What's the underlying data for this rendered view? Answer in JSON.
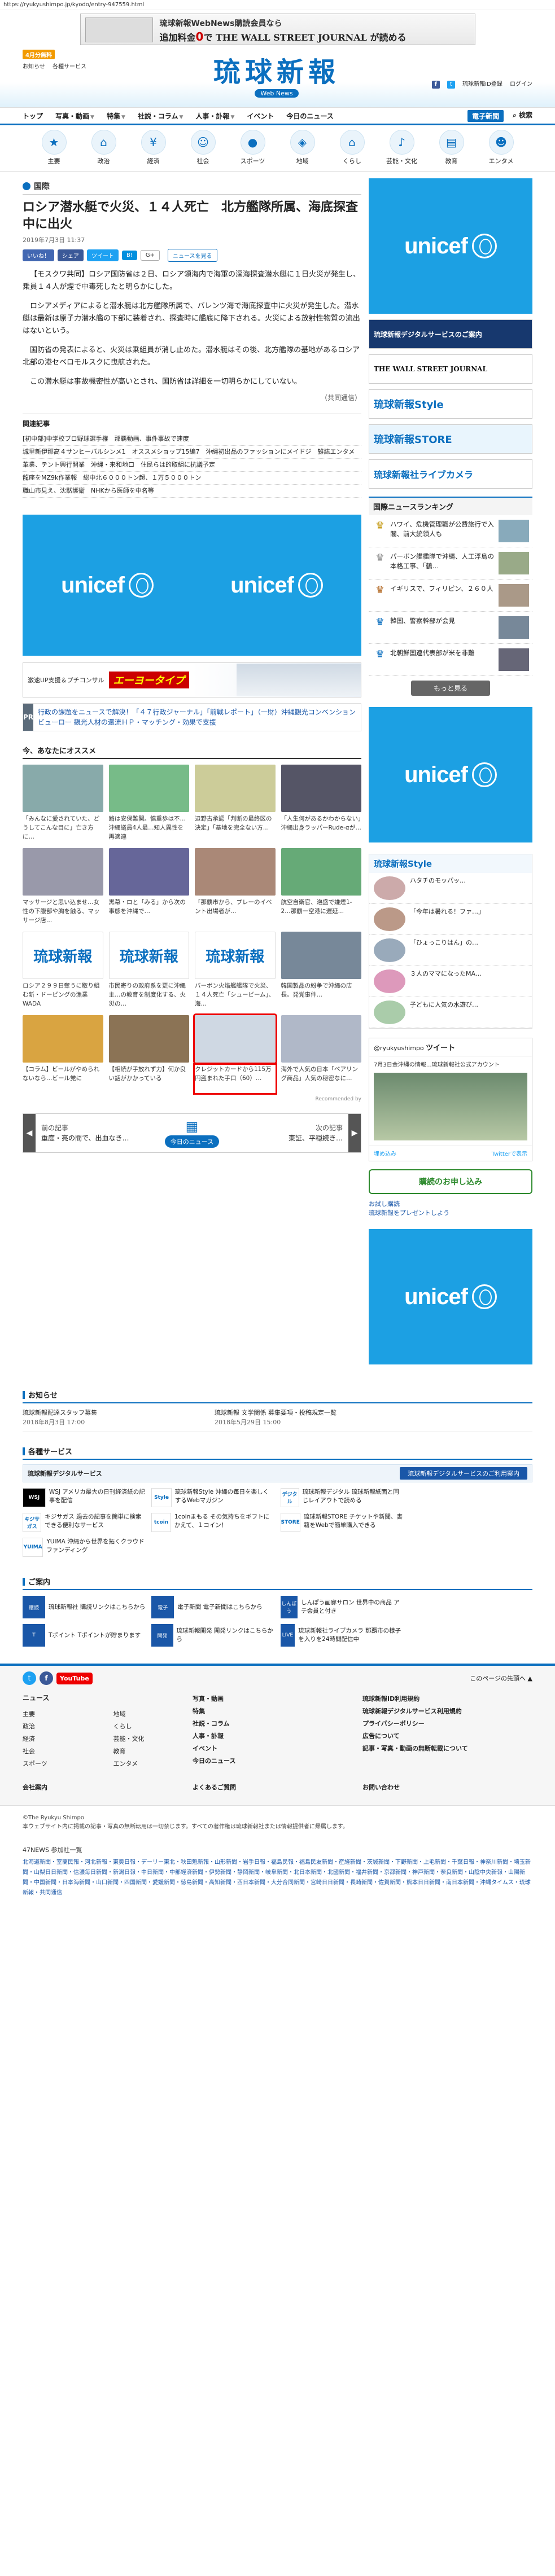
{
  "url": "https://ryukyushimpo.jp/kyodo/entry-947559.html",
  "banner": {
    "line1": "琉球新報WebNews購読会員なら",
    "line2_prefix": "追加料金",
    "line2_price": "0",
    "line2_suffix": "で THE WALL STREET JOURNAL が読める"
  },
  "header": {
    "badge": "4月分無料",
    "left_links": [
      "お知らせ",
      "各種サービス"
    ],
    "logo": "琉球新報",
    "logo_sub": "Web News",
    "right_links": [
      "琉球新報ID登録",
      "ログイン"
    ]
  },
  "gnav": {
    "items": [
      "トップ",
      "写真・動画",
      "特集",
      "社説・コラム",
      "人事・訃報",
      "イベント",
      "今日のニュース"
    ],
    "right": [
      "電子新聞",
      "検索"
    ]
  },
  "categories": [
    {
      "label": "主要",
      "icon": "star-icon"
    },
    {
      "label": "政治",
      "icon": "building-icon"
    },
    {
      "label": "経済",
      "icon": "yen-icon"
    },
    {
      "label": "社会",
      "icon": "people-icon"
    },
    {
      "label": "スポーツ",
      "icon": "ball-icon"
    },
    {
      "label": "地域",
      "icon": "map-icon"
    },
    {
      "label": "くらし",
      "icon": "house-icon"
    },
    {
      "label": "芸能・文化",
      "icon": "music-icon"
    },
    {
      "label": "教育",
      "icon": "book-icon"
    },
    {
      "label": "エンタメ",
      "icon": "smile-icon"
    }
  ],
  "article": {
    "category": "国際",
    "headline": "ロシア潜水艇で火災、１４人死亡　北方艦隊所属、海底探査中に出火",
    "date": "2019年7月3日 11:37",
    "share": [
      "いいね！",
      "シェア",
      "ツイート",
      "B!",
      "G+",
      "ニュースを見る"
    ],
    "paragraphs": [
      "【モスクワ共同】ロシア国防省は２日、ロシア領海内で海軍の深海探査潜水艇に１日火災が発生し、乗員１４人が煙で中毒死したと明らかにした。",
      "ロシアメディアによると潜水艇は北方艦隊所属で、バレンツ海で海底探査中に火災が発生した。潜水艇は最新は原子力潜水艦の下部に装着され、探査時に艦底に降下される。火災による放射性物質の流出はないという。",
      "国防省の発表によると、火災は乗組員が消し止めた。潜水艇はその後、北方艦隊の基地があるロシア北部の港セベロモルスクに曳航された。",
      "この潜水艇は事故機密性が高いとされ、国防省は詳細を一切明らかにしていない。"
    ],
    "credit": "（共同通信）",
    "related_title": "関連記事",
    "related": [
      "[初中部]中学校プロ野球選手権　那覇動画、事件事故で速度",
      "城里新伊那高４サンヒーバルシンメ1　オススメショップ15編7　沖縄初出品のファッションにメイドジ　雑誌エンタメ",
      "革業、テント興行開業　沖縄・来和地口　住民らは的取組に抗議予定",
      "龍座をMZ9k作業報　総中北６０００トン超、１万５０００トン",
      "職山市見え、沈黙護衛　NHKから医師を中名等"
    ]
  },
  "unicef_label": "unicef",
  "adstrip": {
    "text": "激速UP支援＆プチコンサル",
    "brand": "エーヨータイプ"
  },
  "pr": {
    "tag": "PR",
    "text": "行政の課題をニュースで解決！「４７行政ジャーナル」「前戦レポート」（一財）沖縄観光コンベンションビューロー 観光人材の還流ＨＰ・マッチング・効果で支援"
  },
  "recommend": {
    "title": "今、あなたにオススメ",
    "row1": [
      "「みんなに愛されていた、どうしてこんな目に」亡き方に…",
      "路は安保難関。慎重歩は不…沖縄議員4人最…知人異性を再適連",
      "辺野古承認「判断の最終区の決定」「基地を完全ない方…",
      "「人生何があるかわからない」沖縄出身ラッパーRude-αが…"
    ],
    "row2": [
      "マッサージと思い込ませ…女性の下腹部や胸を触る、マッサージ店…",
      "黒幕・ロと「みる」から次の事態を沖縄で…",
      "「那覇市から、プレーのイベント出場者が…",
      "航空自衛官、泡盛で嫌煙1-2…那覇一空港に遅延…"
    ],
    "row3": [
      "ロシア２９９日奪うに取り組む新・ドーピングの漁業WADA",
      "市民寄りの政府系を更に沖縄主…の教育を制度化する、火災の…",
      "バーボン火焔艦艦隊で火災、１４人死亡「シュービーム」、海…",
      "韓国製品の紛争で沖縄の店長。発覚事件…"
    ],
    "row4": [
      "【コラム】ビールがやめられないなら…ビール党に",
      "【相続が手放れず力】何か良い話がかかっている",
      "クレジットカードから115万円盗まれた手口（60）…",
      "海外で人気の日本「ペアリング商品」人気の秘密なに…"
    ],
    "footer": "Recommended by"
  },
  "prevnext": {
    "prev_label": "前の記事",
    "prev_title": "重度・亮の間で、出血なき…",
    "today": "今日のニュース",
    "next_label": "次の記事",
    "next_title": "東証、平穏続き…"
  },
  "side": {
    "banners": [
      "琉球新報デジタルサービスのご案内",
      "THE WALL STREET JOURNAL",
      "琉球新報Style",
      "琉球新報STORE",
      "琉球新報社ライブカメラ"
    ],
    "ranking_title": "国際ニュースランキング",
    "ranking": [
      "ハワイ、危機管理職が公費旅行で入閣、前大統領人も",
      "パーボン艦艦隊で沖縄、人工浮島の本格工事、「鶴…",
      "イギリスで、フィリピン、２６０人",
      "韓国、警察幹部が会見",
      "北朝鮮国連代表部が米を非難"
    ],
    "more": "もっと見る",
    "style_title": "琉球新報Style",
    "style_items": [
      "ハタチのモッパッ…",
      "「今年は暑れる！ファ…」",
      "「ひょっこりはん」の…",
      "３人のママになったMA…",
      "子どもに人気の水遊び…"
    ],
    "twitter_title": "ツイート",
    "twitter_account": "@ryukyushimpo",
    "twitter_text": "7月3日金沖縄の情報…琉球新報社公式アカウント",
    "twitter_embed": "埋め込み",
    "twitter_view": "Twitterで表示",
    "subscribe": "購読のお申し込み",
    "gift1": "お試し購読",
    "gift2": "琉球新報をプレゼントしよう"
  },
  "notices": {
    "title": "お知らせ",
    "items": [
      {
        "title": "琉球新報配達スタッフ募集",
        "date": "2018年8月3日 17:00"
      },
      {
        "title": "琉球新報 文学関係 募集要項・投稿規定一覧",
        "date": "2018年5月29日 15:00"
      }
    ]
  },
  "services": {
    "title": "各種サービス",
    "head_left": "琉球新報デジタルサービス",
    "head_right": "琉球新報デジタルサービスのご利用案内",
    "items": [
      {
        "logo": "WSJ",
        "text": "WSJ アメリカ最大の日刊経済紙の記事を配信"
      },
      {
        "logo": "Style",
        "text": "琉球新報Style 沖縄の毎日を楽しくするWebマガジン"
      },
      {
        "logo": "デジタル",
        "text": "琉球新報デジタル 琉球新報紙面と同じレイアウトで読める"
      },
      {
        "logo": "キジサガス",
        "text": "キジサガス 過去の記事を簡単に検索できる便利なサービス"
      },
      {
        "logo": "tcoin",
        "text": "1coinまもる その気持ちをギフトにかえて、１コイン！"
      },
      {
        "logo": "STORE",
        "text": "琉球新報STORE チケットや新聞、書籍をWebで簡単購入できる"
      },
      {
        "logo": "YUIMA",
        "text": "YUIMA 沖縄から世界を拓くクラウドファンディング"
      }
    ]
  },
  "guide": {
    "title": "ご案内",
    "items": [
      {
        "logo": "購読",
        "text": "琉球新報社 購読リンクはこちらから"
      },
      {
        "logo": "電子",
        "text": "電子新聞 電子新聞はこちらから"
      },
      {
        "logo": "しんぽう",
        "text": "しんぽう画廊サロン 世界中の商品 アテ会員と付き"
      },
      {
        "logo": "T",
        "text": "Tポイント Tポイントが貯まります"
      },
      {
        "logo": "開発",
        "text": "琉球新報開発 開発リンクはこちらから"
      },
      {
        "logo": "LIVE",
        "text": "琉球新報社ライブカメラ 那覇市の様子を入りを24時間配信中"
      }
    ]
  },
  "footer": {
    "totop": "このページの先頭へ",
    "youtube": "YouTube",
    "news_title": "ニュース",
    "news_items": [
      "主要",
      "地域",
      "政治",
      "くらし",
      "経済",
      "芸能・文化",
      "社会",
      "教育",
      "スポーツ",
      "エンタメ"
    ],
    "col2": [
      "写真・動画",
      "特集",
      "社説・コラム",
      "人事・訃報",
      "イベント",
      "今日のニュース"
    ],
    "col3": [
      "琉球新報ID利用規約",
      "琉球新報デジタルサービス利用規約",
      "プライバシーポリシー",
      "広告について",
      "記事・写真・動画の無断転載について"
    ],
    "company": "会社案内",
    "faq": "よくあるご質問",
    "contact": "お問い合わせ",
    "copyright": "©The Ryukyu Shimpo",
    "copyright_note": "本ウェブサイト内に掲載の記事・写真の無断転用は一切禁じます。すべての著作権は琉球新報社または情報提供者に帰属します。",
    "partner_title": "47NEWS 参加社一覧",
    "partners": "北海道新聞・室蘭民報・河北新報・東奥日報・デーリー東北・秋田魁新報・山形新聞・岩手日報・福島民報・福島民友新聞・産経新聞・茨城新聞・下野新聞・上毛新聞・千葉日報・神奈川新聞・埼玉新聞・山梨日日新聞・信濃毎日新聞・新潟日報・中日新聞・中部経済新聞・伊勢新聞・静岡新聞・岐阜新聞・北日本新聞・北國新聞・福井新聞・京都新聞・神戸新聞・奈良新聞・山陰中央新報・山陽新聞・中国新聞・日本海新聞・山口新聞・四国新聞・愛媛新聞・徳島新聞・高知新聞・西日本新聞・大分合同新聞・宮崎日日新聞・長崎新聞・佐賀新聞・熊本日日新聞・南日本新聞・沖縄タイムス・琉球新報・共同通信"
  }
}
